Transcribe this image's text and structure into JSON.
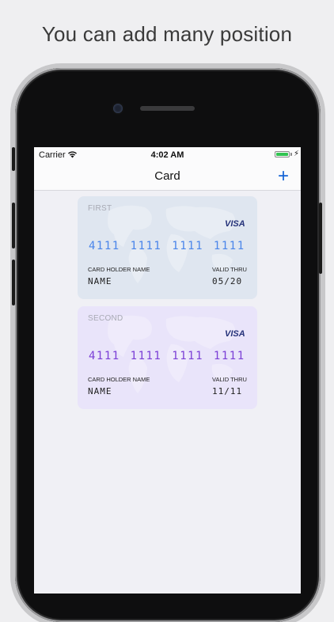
{
  "headline": "You can add many position",
  "status_bar": {
    "carrier": "Carrier",
    "time": "4:02 AM",
    "bolt": "⚡"
  },
  "navbar": {
    "title": "Card",
    "add_label": "+"
  },
  "cards": [
    {
      "name": "FIRST",
      "brand": "VISA",
      "number": "4111 1111 1111 1111",
      "holder_label": "CARD HOLDER NAME",
      "holder_name": "NAME",
      "valid_label": "VALID THRU",
      "expiry": "05/20",
      "color": "#dfe6f0",
      "number_color": "#4a85ea"
    },
    {
      "name": "SECOND",
      "brand": "VISA",
      "number": "4111 1111 1111 1111",
      "holder_label": "CARD HOLDER NAME",
      "holder_name": "NAME",
      "valid_label": "VALID THRU",
      "expiry": "11/11",
      "color": "#e9e4fa",
      "number_color": "#7b3fd6"
    }
  ],
  "accent_color": "#1463d6"
}
